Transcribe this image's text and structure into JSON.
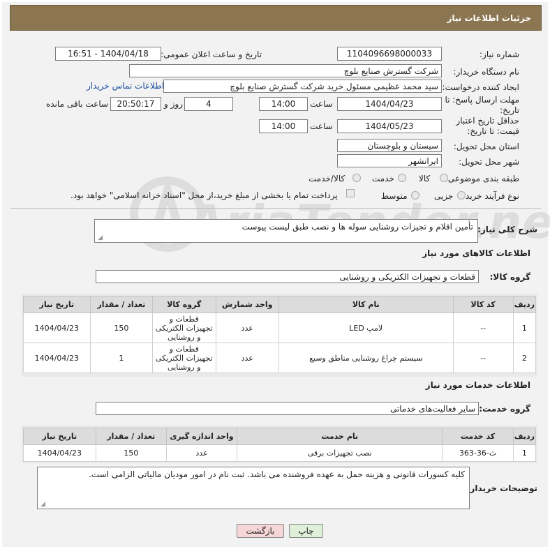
{
  "header": {
    "title": "جزئیات اطلاعات نیاز"
  },
  "fields": {
    "need_number_label": "شماره نیاز:",
    "need_number": "1104096698000033",
    "announce_label": "تاریخ و ساعت اعلان عمومی:",
    "announce_value": "1404/04/18 - 16:51",
    "buyer_org_label": "نام دستگاه خریدار:",
    "buyer_org": "شرکت گسترش صنایع بلوچ",
    "requester_label": "ایجاد کننده درخواست:",
    "requester": "سید محمد  عظیمی  مسئول خرید  شرکت گسترش صنایع بلوچ",
    "buyer_contact_link": "اطلاعات تماس خریدار",
    "reply_deadline_label": "مهلت ارسال پاسخ: تا تاریخ:",
    "reply_date": "1404/04/23",
    "time_label": "ساعت",
    "reply_time": "14:00",
    "days_value": "4",
    "days_label": "روز و",
    "remaining_time": "20:50:17",
    "remaining_label": "ساعت باقی مانده",
    "price_validity_label": "حداقل تاریخ اعتبار قیمت: تا تاریخ:",
    "price_date": "1404/05/23",
    "price_time": "14:00",
    "province_label": "استان محل تحویل:",
    "province": "سیستان و بلوچستان",
    "city_label": "شهر محل تحویل:",
    "city": "ایرانشهر",
    "category_label": "طبقه بندی موضوعی:",
    "category_options": [
      "کالا",
      "خدمت",
      "کالا/خدمت"
    ],
    "process_label": "نوع فرآیند خرید :",
    "process_options": [
      "جزیی",
      "متوسط"
    ],
    "payment_note": "پرداخت تمام یا بخشی از مبلغ خرید،از محل \"اسناد خزانه اسلامی\" خواهد بود.",
    "description_label": "شرح کلی نیاز:",
    "description": "تأمین اقلام و تجیزات روشنایی سوله ها  و نصب طبق لیست پیوست"
  },
  "goods_section": {
    "title": "اطلاعات کالاهای مورد نیاز",
    "group_label": "گروه کالا:",
    "group_value": "قطعات و تجهیزات الکتریکی و روشنایی",
    "columns": [
      "ردیف",
      "کد کالا",
      "نام کالا",
      "واحد شمارش",
      "گروه کالا",
      "تعداد / مقدار",
      "تاریخ نیاز"
    ],
    "rows": [
      {
        "index": "1",
        "code": "--",
        "name": "لامپ LED",
        "unit": "عدد",
        "group": "قطعات و تجهیزات الکتریکی و روشنایی",
        "qty": "150",
        "date": "1404/04/23"
      },
      {
        "index": "2",
        "code": "--",
        "name": "سیستم چراغ روشنایی مناطق وسیع",
        "unit": "عدد",
        "group": "قطعات و تجهیزات الکتریکی و روشنایی",
        "qty": "1",
        "date": "1404/04/23"
      }
    ]
  },
  "services_section": {
    "title": "اطلاعات خدمات مورد نیاز",
    "group_label": "گروه خدمت:",
    "group_value": "سایر فعالیت‌های خدماتی",
    "columns": [
      "ردیف",
      "کد خدمت",
      "نام خدمت",
      "واحد اندازه گیری",
      "تعداد / مقدار",
      "تاریخ نیاز"
    ],
    "rows": [
      {
        "index": "1",
        "code": "ث-36-363",
        "name": "نصب تجهیزات برقی",
        "unit": "عدد",
        "qty": "150",
        "date": "1404/04/23"
      }
    ]
  },
  "buyer_notes_label": "توضیحات خریدار:",
  "buyer_notes": "کلیه کسورات قانونی و هزینه حمل به عهده فروشنده می باشد. ثبت نام در امور مودیان مالیاتی الزامی است.",
  "buttons": {
    "print": "چاپ",
    "back": "بازگشت"
  },
  "watermark": {
    "text": "AriaTender.neT"
  },
  "colors": {
    "header_bg": "#8c7651",
    "link": "#1a4fa0",
    "back_btn": "#f6d6d6",
    "print_btn": "#dff0d8"
  }
}
